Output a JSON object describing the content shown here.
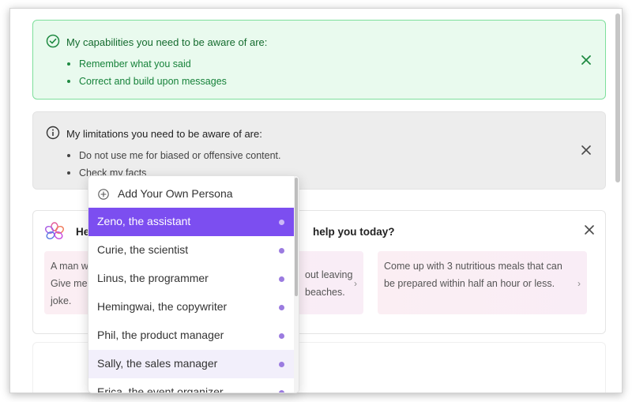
{
  "capabilities": {
    "title": "My capabilities you need to be aware of are:",
    "items": [
      "Remember what you said",
      "Correct and build upon messages"
    ],
    "icon": "check-circle-icon",
    "close_icon": "close-icon",
    "accent_color": "#16823a"
  },
  "limitations": {
    "title": "My limitations you need to be aware of are:",
    "items": [
      "Do not use me for biased or offensive content.",
      "Check my facts"
    ],
    "icon": "info-circle-icon",
    "close_icon": "close-icon"
  },
  "assistant_card": {
    "greeting_visible_start": "He",
    "greeting_visible_end": "help you today?",
    "logo_icon": "flower-logo-icon",
    "close_icon": "close-icon",
    "suggestions": [
      {
        "visible_left": "A man w\nGive me\njoke.",
        "visible_right": "out leaving\nbeaches."
      },
      {
        "text": "Come up with 3 nutritious meals that can be prepared within half an hour or less."
      }
    ],
    "chevron": "›"
  },
  "persona_dropdown": {
    "add_label": "Add Your Own Persona",
    "add_icon": "plus-circle-icon",
    "selected_color": "#7c4ef0",
    "items": [
      {
        "label": "Zeno, the assistant",
        "state": "selected"
      },
      {
        "label": "Curie, the scientist",
        "state": "normal"
      },
      {
        "label": "Linus, the programmer",
        "state": "normal"
      },
      {
        "label": "Hemingwai, the copywriter",
        "state": "normal"
      },
      {
        "label": "Phil, the product manager",
        "state": "normal"
      },
      {
        "label": "Sally, the sales manager",
        "state": "hovered"
      },
      {
        "label": "Erica, the event organizer",
        "state": "partially-visible"
      }
    ]
  }
}
